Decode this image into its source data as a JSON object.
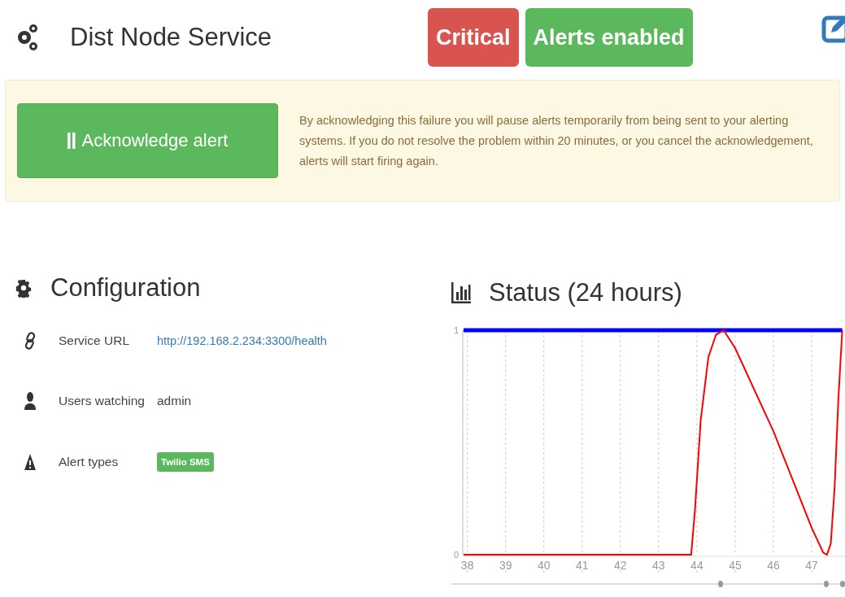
{
  "header": {
    "title": "Dist Node Service",
    "badges": [
      {
        "label": "Critical",
        "kind": "danger"
      },
      {
        "label": "Alerts enabled",
        "kind": "success"
      }
    ]
  },
  "alert": {
    "button": "Acknowledge alert",
    "message": "By acknowledging this failure you will pause alerts temporarily from being sent to your alerting systems. If you do not resolve the problem within 20 minutes, or you cancel the acknowledgement, alerts will start firing again."
  },
  "configuration": {
    "title": "Configuration",
    "rows": [
      {
        "kind": "link",
        "label": "Service URL",
        "value": "http://192.168.2.234:3300/health"
      },
      {
        "kind": "user",
        "label": "Users watching",
        "value": "admin"
      },
      {
        "kind": "tag",
        "label": "Alert types",
        "value": "Twilio SMS"
      }
    ]
  },
  "status": {
    "title": "Status (24 hours)",
    "chart_data": {
      "type": "line",
      "xlim": [
        37.88,
        47.85
      ],
      "ylim": [
        0,
        1
      ],
      "grid": true,
      "xticks": [
        38,
        39,
        40,
        41,
        42,
        43,
        44,
        45,
        46,
        47
      ],
      "yticks": [
        0,
        1
      ],
      "series": [
        {
          "color": "#0000ff",
          "x": [
            37.9,
            47.8
          ],
          "values": [
            1,
            1
          ]
        },
        {
          "color": "#ff0000",
          "x": [
            37.9,
            43.85,
            43.95,
            44.1,
            44.3,
            44.5,
            44.7,
            45,
            46,
            47,
            47.3,
            47.4,
            47.5,
            47.6,
            47.7,
            47.8
          ],
          "values": [
            0,
            0,
            0.2,
            0.6,
            0.88,
            0.98,
            1,
            0.92,
            0.55,
            0.12,
            0.01,
            0,
            0.05,
            0.3,
            0.7,
            1
          ]
        }
      ]
    }
  }
}
